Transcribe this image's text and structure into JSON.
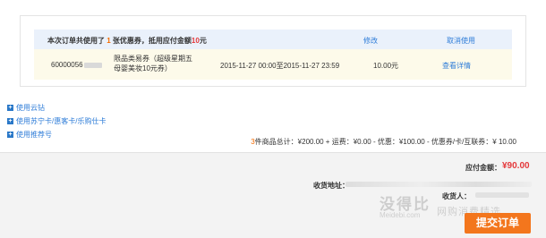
{
  "coupon": {
    "summary_prefix": "本次订单共使用了",
    "count": "1",
    "summary_mid": "张优惠券，抵用应付金额",
    "deduct": "10",
    "summary_suffix": "元",
    "modify_label": "修改",
    "cancel_label": "取消使用",
    "rows": [
      {
        "code": "60000056",
        "name": "限品类易券（超级星期五母婴美妆10元券）",
        "dates": "2015-11-27 00:00至2015-11-27 23:59",
        "amount": "10.00元",
        "detail_label": "查看详情"
      }
    ]
  },
  "options": [
    {
      "label": "使用云钻",
      "icon": "plus-icon"
    },
    {
      "label": "使用苏宁卡/惠客卡/乐购仕卡",
      "icon": "plus-icon"
    },
    {
      "label": "使用推荐号",
      "icon": "plus-icon"
    }
  ],
  "totals": {
    "qty": "3",
    "text": "件商品总计：¥200.00 + 运费：¥0.00 - 优惠：¥100.00 - 优惠券/卡/互联券：¥ 10.00"
  },
  "payment": {
    "due_label": "应付金额：",
    "due_value": "¥90.00"
  },
  "shipping": {
    "address_label": "收货地址：",
    "receiver_label": "收货人："
  },
  "watermark": {
    "main": "没得比",
    "sub": "Meidebi.com",
    "slogan": "网购消费精选"
  },
  "submit_label": "提交订单"
}
